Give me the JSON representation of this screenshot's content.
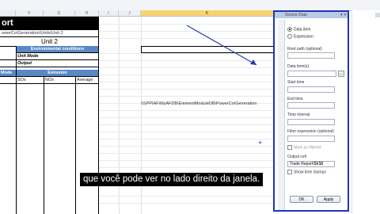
{
  "columns": {
    "blank_a": "",
    "f": "F",
    "g": "G",
    "h": "H",
    "i": "I",
    "j": "J",
    "k": "K"
  },
  "sheet": {
    "title": "ort",
    "path": "owerCo\\Generation\\Units\\Unit 2",
    "unit": "Unit 2",
    "env_header": "Environmental conditions",
    "unit_mode": "Unit Mode",
    "output": "Output",
    "mode_label": "Mode",
    "emission_header": "Emission",
    "col_sox": "SOx",
    "col_nox": "NOx",
    "col_average": "Average",
    "long_path": "\\\\SPPIAF\\MyAFDB\\ElementModuleDB\\PowerCo\\Generation"
  },
  "panel": {
    "header": "Source Data",
    "radio_data_item": "Data item",
    "radio_expression": "Expression",
    "root_path_label": "Root path (optional)",
    "data_items_label": "Data item(s)",
    "start_time_label": "Start time",
    "end_time_label": "End time",
    "time_interval_label": "Time interval",
    "filter_label": "Filter expression (optional)",
    "mark_as_filtered": "Mark as filtered",
    "output_cell_label": "Output cell",
    "output_cell_value": "Trade Report!$E$8",
    "show_time_stamps": "Show time stamps",
    "ok": "OK",
    "apply": "Apply"
  },
  "caption": "que você pode ver no lado direito da janela.",
  "colors": {
    "accent_blue": "#1f35b5",
    "header_blue": "#5a87c5",
    "selected_col": "#f7d56e"
  }
}
